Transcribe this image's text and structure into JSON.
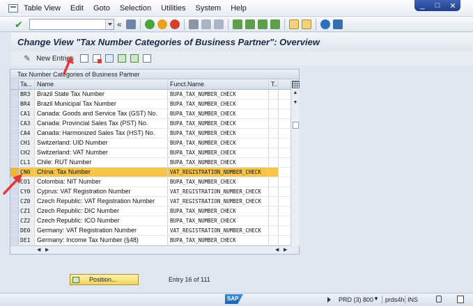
{
  "menu": [
    "Table View",
    "Edit",
    "Goto",
    "Selection",
    "Utilities",
    "System",
    "Help"
  ],
  "window_controls": [
    "_",
    "□",
    "✕"
  ],
  "page_title": "Change View \"Tax Number Categories of Business Partner\": Overview",
  "app_toolbar": {
    "new_entries": "New Entries"
  },
  "table": {
    "title": "Tax Number Categories of Business Partner",
    "columns": {
      "code": "Ta...",
      "name": "Name",
      "func": "Funct.Name",
      "t": "T.."
    },
    "rows": [
      {
        "code": "BR3",
        "name": "Brazil State Tax Number",
        "func": "BUPA_TAX_NUMBER_CHECK"
      },
      {
        "code": "BR4",
        "name": "Brazil Municipal Tax Number",
        "func": "BUPA_TAX_NUMBER_CHECK"
      },
      {
        "code": "CA1",
        "name": "Canada: Goods and Service Tax (GST) No.",
        "func": "BUPA_TAX_NUMBER_CHECK"
      },
      {
        "code": "CA3",
        "name": "Canada: Provincial Sales Tax (PST) No.",
        "func": "BUPA_TAX_NUMBER_CHECK"
      },
      {
        "code": "CA4",
        "name": "Canada: Harmonized Sales Tax (HST) No.",
        "func": "BUPA_TAX_NUMBER_CHECK"
      },
      {
        "code": "CH1",
        "name": "Switzerland: UID Number",
        "func": "BUPA_TAX_NUMBER_CHECK"
      },
      {
        "code": "CH2",
        "name": "Switzerland: VAT Number",
        "func": "BUPA_TAX_NUMBER_CHECK"
      },
      {
        "code": "CL1",
        "name": "Chile: RUT Number",
        "func": "BUPA_TAX_NUMBER_CHECK"
      },
      {
        "code": "CN0",
        "name": "China: Tax Number",
        "func": "VAT_REGISTRATION_NUMBER_CHECK"
      },
      {
        "code": "CO1",
        "name": "Colombia: NIT Number",
        "func": "BUPA_TAX_NUMBER_CHECK"
      },
      {
        "code": "CY0",
        "name": "Cyprus: VAT Registration Number",
        "func": "VAT_REGISTRATION_NUMBER_CHECK"
      },
      {
        "code": "CZ0",
        "name": "Czech Republic: VAT Registration Number",
        "func": "VAT_REGISTRATION_NUMBER_CHECK"
      },
      {
        "code": "CZ1",
        "name": "Czech Republic: DIC Number",
        "func": "BUPA_TAX_NUMBER_CHECK"
      },
      {
        "code": "CZ2",
        "name": "Czech Republic: ICO Number",
        "func": "BUPA_TAX_NUMBER_CHECK"
      },
      {
        "code": "DE0",
        "name": "Germany: VAT Registration Number",
        "func": "VAT_REGISTRATION_NUMBER_CHECK"
      },
      {
        "code": "DE1",
        "name": "Germany: Income Tax Number (§48)",
        "func": "BUPA_TAX_NUMBER_CHECK"
      }
    ],
    "selected_code": "CN0"
  },
  "position_button": "Position...",
  "entry_info": "Entry 16 of 111",
  "statusbar": {
    "logo": "SAP",
    "system": "PRD (3) 800",
    "host": "prds4h",
    "mode": "INS"
  },
  "colors": {
    "selected_row": "#f7c54a",
    "annotation": "#e03a3a",
    "title_text": "#1b2a44"
  }
}
